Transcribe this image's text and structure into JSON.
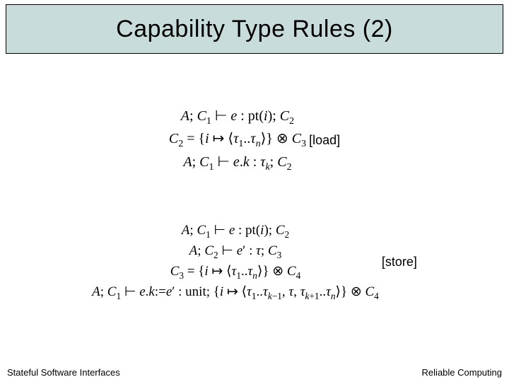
{
  "title": "Capability Type Rules (2)",
  "rules": {
    "load": {
      "premise1": "A; C₁ ⊢ e : pt(i); C₂",
      "premise2": "C₂ = {i ↦ ⟨τ₁..τₙ⟩} ⊗ C₃",
      "conclusion": "A; C₁ ⊢ e.k : τₖ; C₂",
      "label": "[load]"
    },
    "store": {
      "premise1": "A; C₁ ⊢ e : pt(i); C₂",
      "premise2": "A; C₂ ⊢ e′ : τ; C₃",
      "premise3": "C₃ = {i ↦ ⟨τ₁..τₙ⟩} ⊗ C₄",
      "conclusion": "A; C₁ ⊢ e.k:=e′ : unit; {i ↦ ⟨τ₁..τₖ₋₁, τ, τₖ₊₁..τₙ⟩} ⊗ C₄",
      "label": "[store]"
    }
  },
  "footer": {
    "left": "Stateful Software Interfaces",
    "right": "Reliable Computing"
  }
}
